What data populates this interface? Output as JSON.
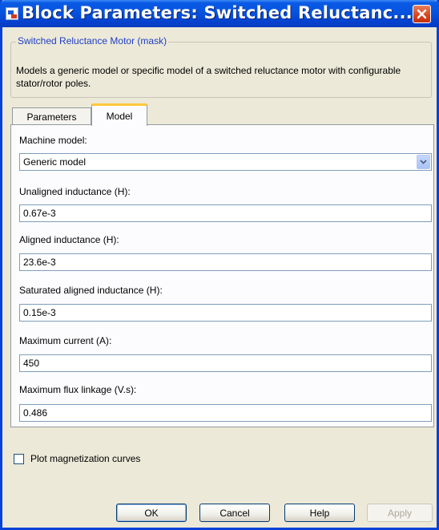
{
  "window": {
    "title": "Block Parameters: Switched Reluctanc..."
  },
  "mask": {
    "legend": "Switched Reluctance Motor (mask)",
    "description": "Models a generic model or specific model of a switched reluctance motor with configurable stator/rotor poles."
  },
  "tabs": [
    {
      "label": "Parameters",
      "active": false
    },
    {
      "label": "Model",
      "active": true
    }
  ],
  "fields": {
    "machine_model": {
      "label": "Machine model:",
      "value": "Generic model"
    },
    "unaligned_inductance": {
      "label": "Unaligned inductance (H):",
      "value": "0.67e-3"
    },
    "aligned_inductance": {
      "label": "Aligned inductance (H):",
      "value": "23.6e-3"
    },
    "saturated_aligned_inductance": {
      "label": "Saturated aligned inductance (H):",
      "value": "0.15e-3"
    },
    "maximum_current": {
      "label": "Maximum current (A):",
      "value": "450"
    },
    "maximum_flux_linkage": {
      "label": "Maximum flux linkage (V.s):",
      "value": "0.486"
    }
  },
  "plot_checkbox": {
    "label": "Plot magnetization curves",
    "checked": false
  },
  "buttons": {
    "ok": "OK",
    "cancel": "Cancel",
    "help": "Help",
    "apply": "Apply"
  },
  "icons": {
    "app": "simulink-block-icon",
    "close": "close-icon",
    "dropdown": "chevron-down-icon"
  },
  "colors": {
    "titlebar": "#0653de",
    "dialog_bg": "#ece9d8",
    "active_tab_accent": "#ffc83c",
    "legend_text": "#1f3ec8"
  }
}
